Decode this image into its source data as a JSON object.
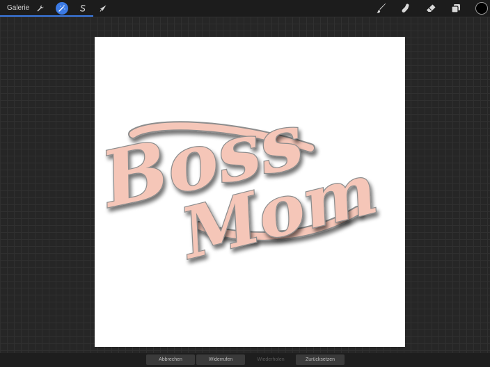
{
  "app": {
    "gallery_label": "Galerie"
  },
  "toolbar": {
    "left_tools": [
      {
        "icon": "wrench-icon",
        "active": false
      },
      {
        "icon": "magic-wand-icon",
        "active": true
      },
      {
        "icon": "selection-s-icon",
        "active": false
      },
      {
        "icon": "cursor-arrow-icon",
        "active": false
      }
    ],
    "right_tools": [
      "brush-icon",
      "smudge-icon",
      "eraser-icon",
      "layers-icon"
    ],
    "current_color": "#000000",
    "accent_color": "#3b7ae4",
    "progress": 0.19
  },
  "artwork": {
    "line1": "Boss",
    "line2": "Mom",
    "fill_color": "#f5c6b8",
    "outline_color": "#8d8d8d",
    "canvas_color": "#ffffff"
  },
  "bottom_actions": {
    "cancel": "Abbrechen",
    "undo": "Widerrufen",
    "redo": "Wiederholen",
    "reset": "Zurücksetzen"
  }
}
